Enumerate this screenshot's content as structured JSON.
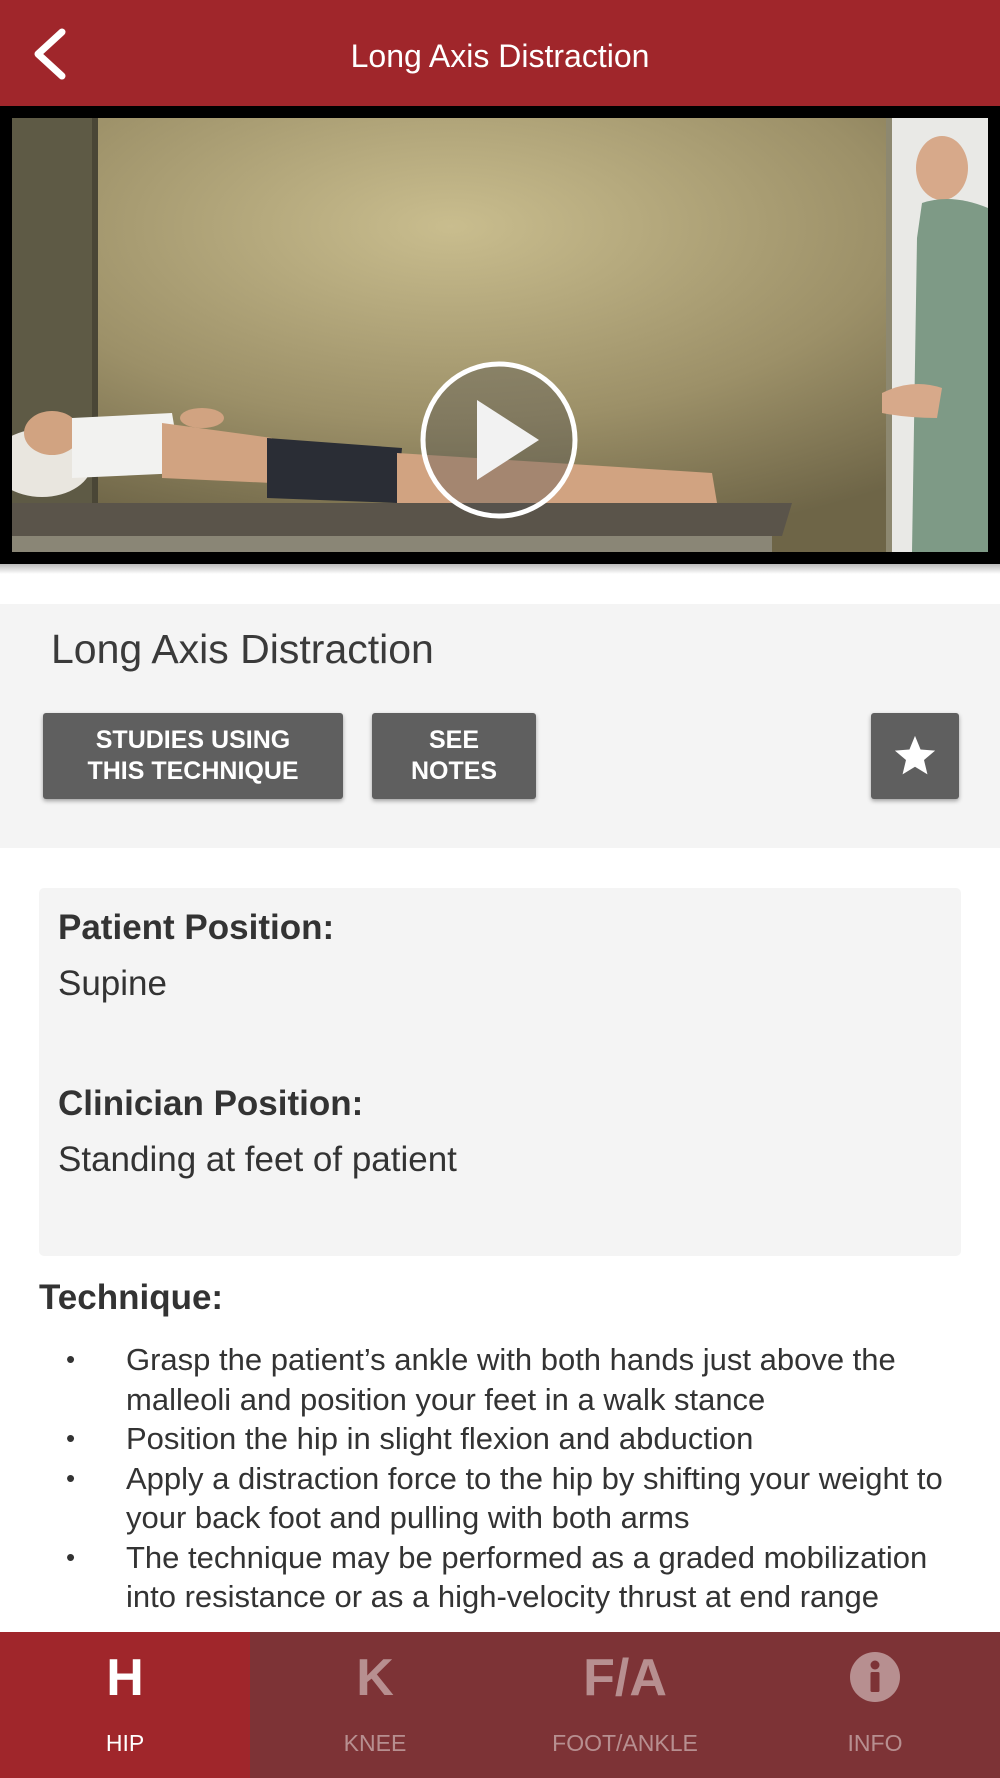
{
  "header": {
    "title": "Long Axis Distraction",
    "back_icon": "chevron-left-icon"
  },
  "video": {
    "play_icon": "play-icon"
  },
  "technique": {
    "title": "Long Axis Distraction",
    "studies_button": {
      "line1": "STUDIES USING",
      "line2": "THIS TECHNIQUE"
    },
    "notes_button": {
      "line1": "SEE",
      "line2": "NOTES"
    },
    "favorite_icon": "star-icon"
  },
  "positions": {
    "patient_label": "Patient Position:",
    "patient_value": "Supine",
    "clinician_label": "Clinician Position:",
    "clinician_value": "Standing at feet of patient"
  },
  "technique_section": {
    "heading": "Technique:",
    "bullet": "•",
    "steps": [
      "Grasp the patient’s ankle with both hands just above the malleoli and position your feet in a walk stance",
      "Position the hip in slight flexion and abduction",
      "Apply a distraction force to the hip by shifting your weight to your back foot and pulling with both arms",
      "The technique may be performed as a graded mobilization into resistance or as a high-velocity thrust at end range"
    ]
  },
  "tabs": [
    {
      "glyph": "H",
      "label": "HIP",
      "active": true
    },
    {
      "glyph": "K",
      "label": "KNEE",
      "active": false
    },
    {
      "glyph": "F/A",
      "label": "FOOT/ANKLE",
      "active": false
    },
    {
      "glyph": "i",
      "label": "INFO",
      "active": false
    }
  ],
  "colors": {
    "brand": "#a0262b",
    "tab_inactive": "#7d3336",
    "button": "#5f5f5f",
    "panel": "#f4f4f4"
  }
}
